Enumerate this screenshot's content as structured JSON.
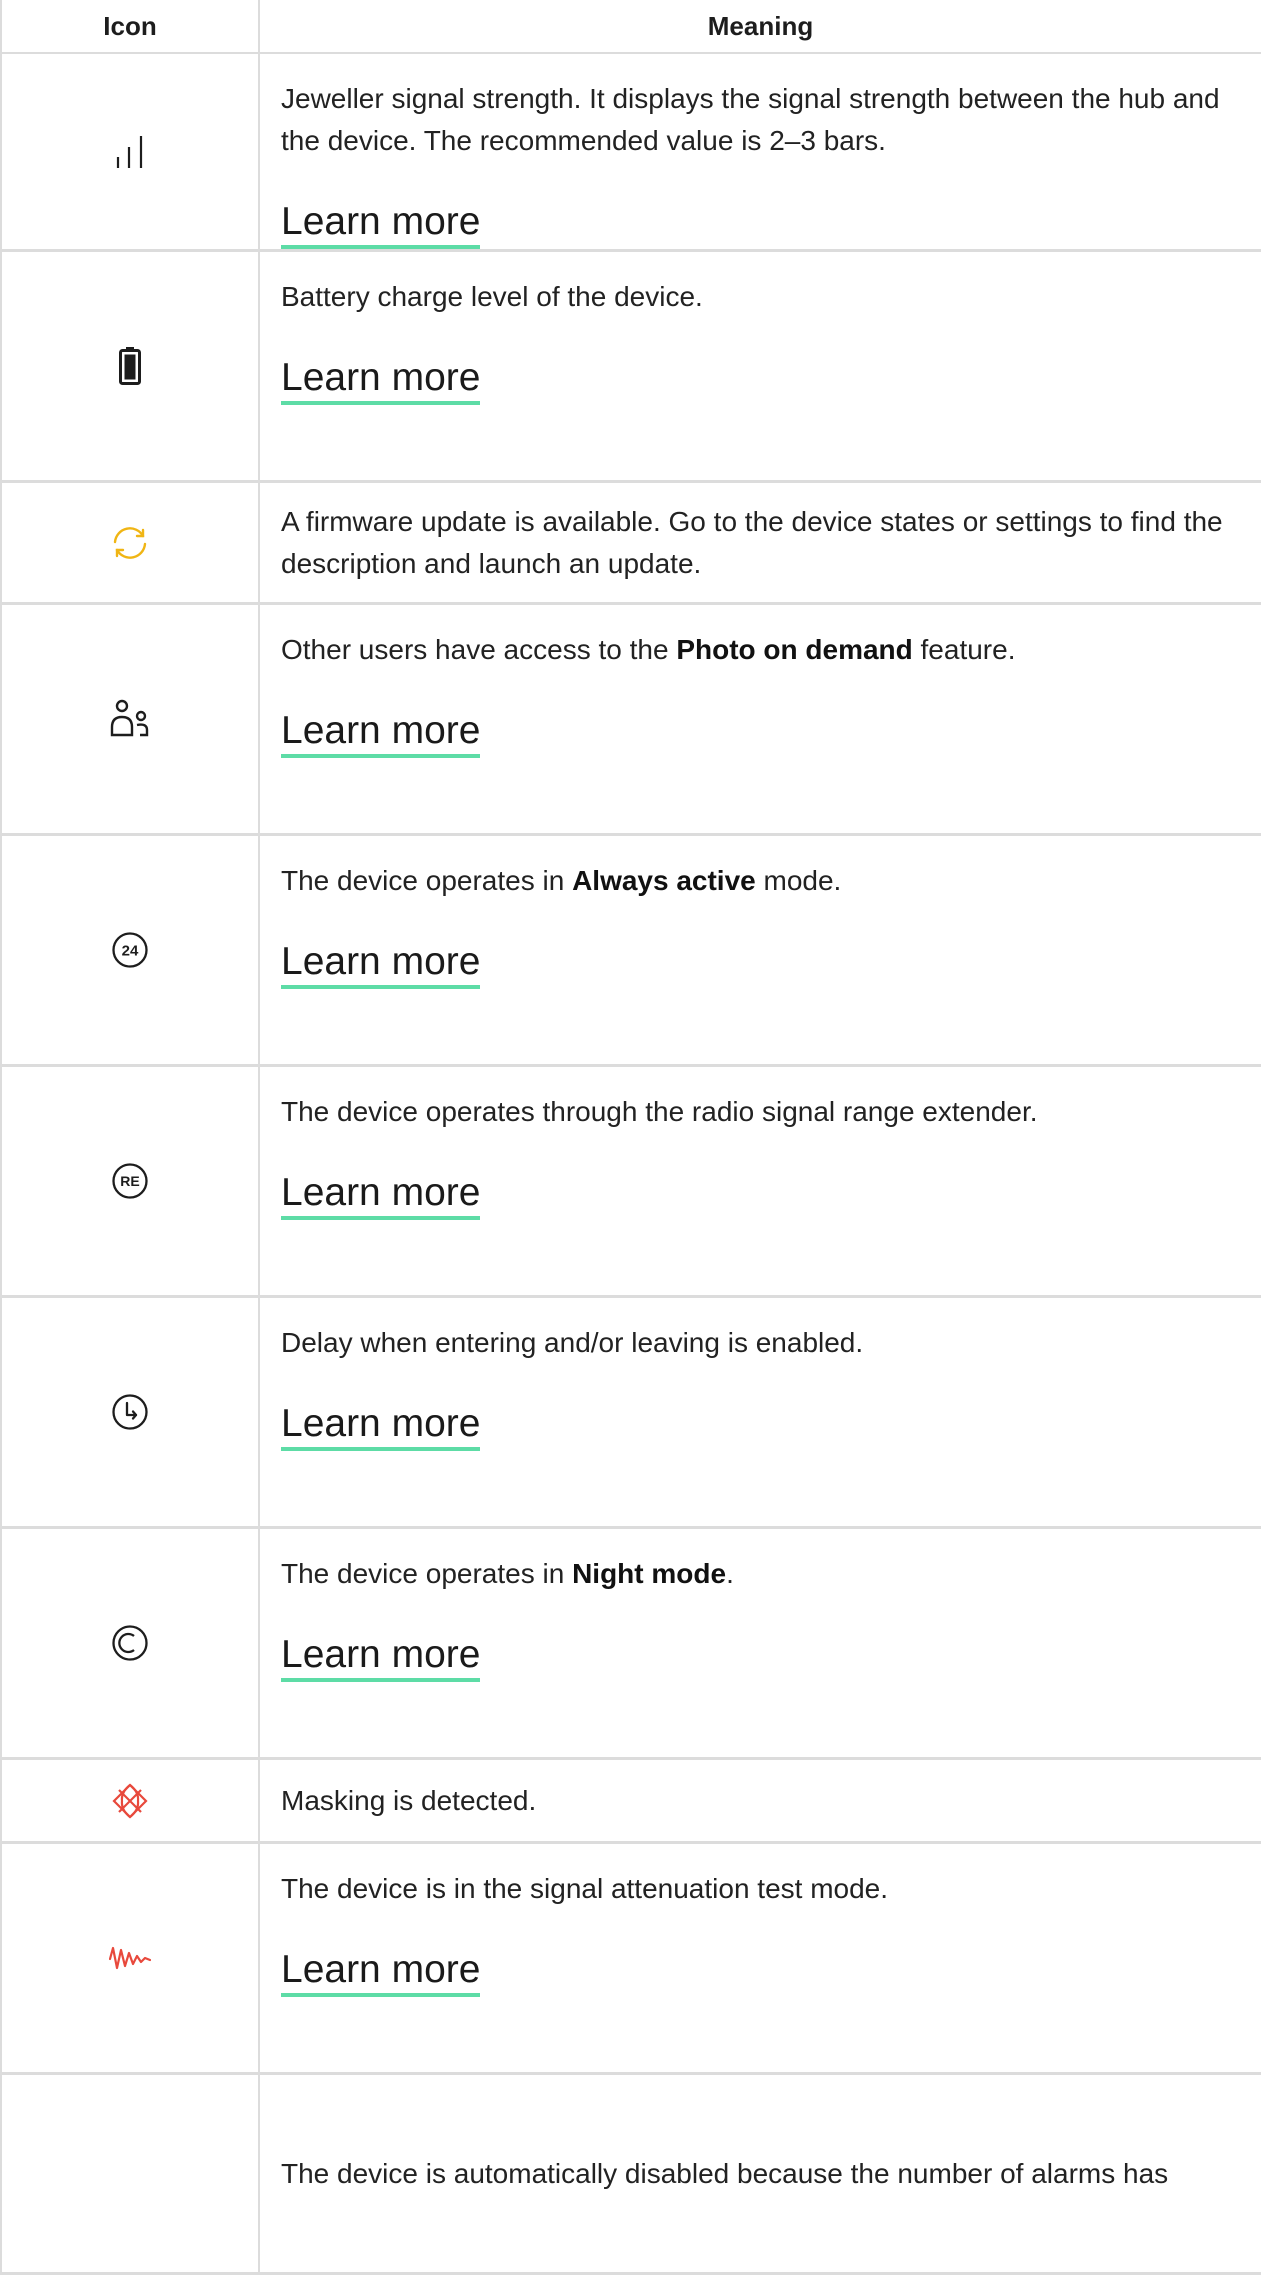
{
  "table": {
    "headers": {
      "icon": "Icon",
      "meaning": "Meaning"
    },
    "rows": [
      {
        "icon": "signal-strength-icon",
        "parts": [
          {
            "t": "Jeweller signal strength. It displays the signal strength between the hub and the device. The recommended value is 2–3 bars."
          }
        ],
        "link": "Learn more"
      },
      {
        "icon": "battery-icon",
        "parts": [
          {
            "t": "Battery charge level of the device."
          }
        ],
        "link": "Learn more"
      },
      {
        "icon": "firmware-update-icon",
        "parts": [
          {
            "t": "A firmware update is available. Go to the device states or settings to find the description and launch an update."
          }
        ],
        "link": null
      },
      {
        "icon": "users-icon",
        "parts": [
          {
            "t": "Other users have access to the "
          },
          {
            "t": "Photo on demand",
            "b": true
          },
          {
            "t": " feature."
          }
        ],
        "link": "Learn more"
      },
      {
        "icon": "always-active-24-icon",
        "parts": [
          {
            "t": "The device operates in "
          },
          {
            "t": "Always active",
            "b": true
          },
          {
            "t": " mode."
          }
        ],
        "link": "Learn more"
      },
      {
        "icon": "range-extender-icon",
        "parts": [
          {
            "t": "The device operates through the radio signal range extender."
          }
        ],
        "link": "Learn more"
      },
      {
        "icon": "delay-clock-icon",
        "parts": [
          {
            "t": "Delay when entering and/or leaving is enabled."
          }
        ],
        "link": "Learn more"
      },
      {
        "icon": "night-mode-icon",
        "parts": [
          {
            "t": "The device operates in "
          },
          {
            "t": "Night mode",
            "b": true
          },
          {
            "t": "."
          }
        ],
        "link": "Learn more"
      },
      {
        "icon": "masking-icon",
        "parts": [
          {
            "t": "Masking is detected."
          }
        ],
        "link": null
      },
      {
        "icon": "attenuation-test-icon",
        "parts": [
          {
            "t": "The device is in the signal attenuation test mode."
          }
        ],
        "link": "Learn more"
      },
      {
        "icon": "auto-disabled-icon",
        "parts": [
          {
            "t": "The device is automatically disabled because the number of alarms has"
          }
        ],
        "link": null
      }
    ]
  },
  "icon_colors": {
    "firmware-update-icon": "#f0b514",
    "masking-icon": "#e8493c",
    "attenuation-test-icon": "#e8493c",
    "default": "#1d1d1d"
  },
  "link_underline_color": "#5ddca6"
}
